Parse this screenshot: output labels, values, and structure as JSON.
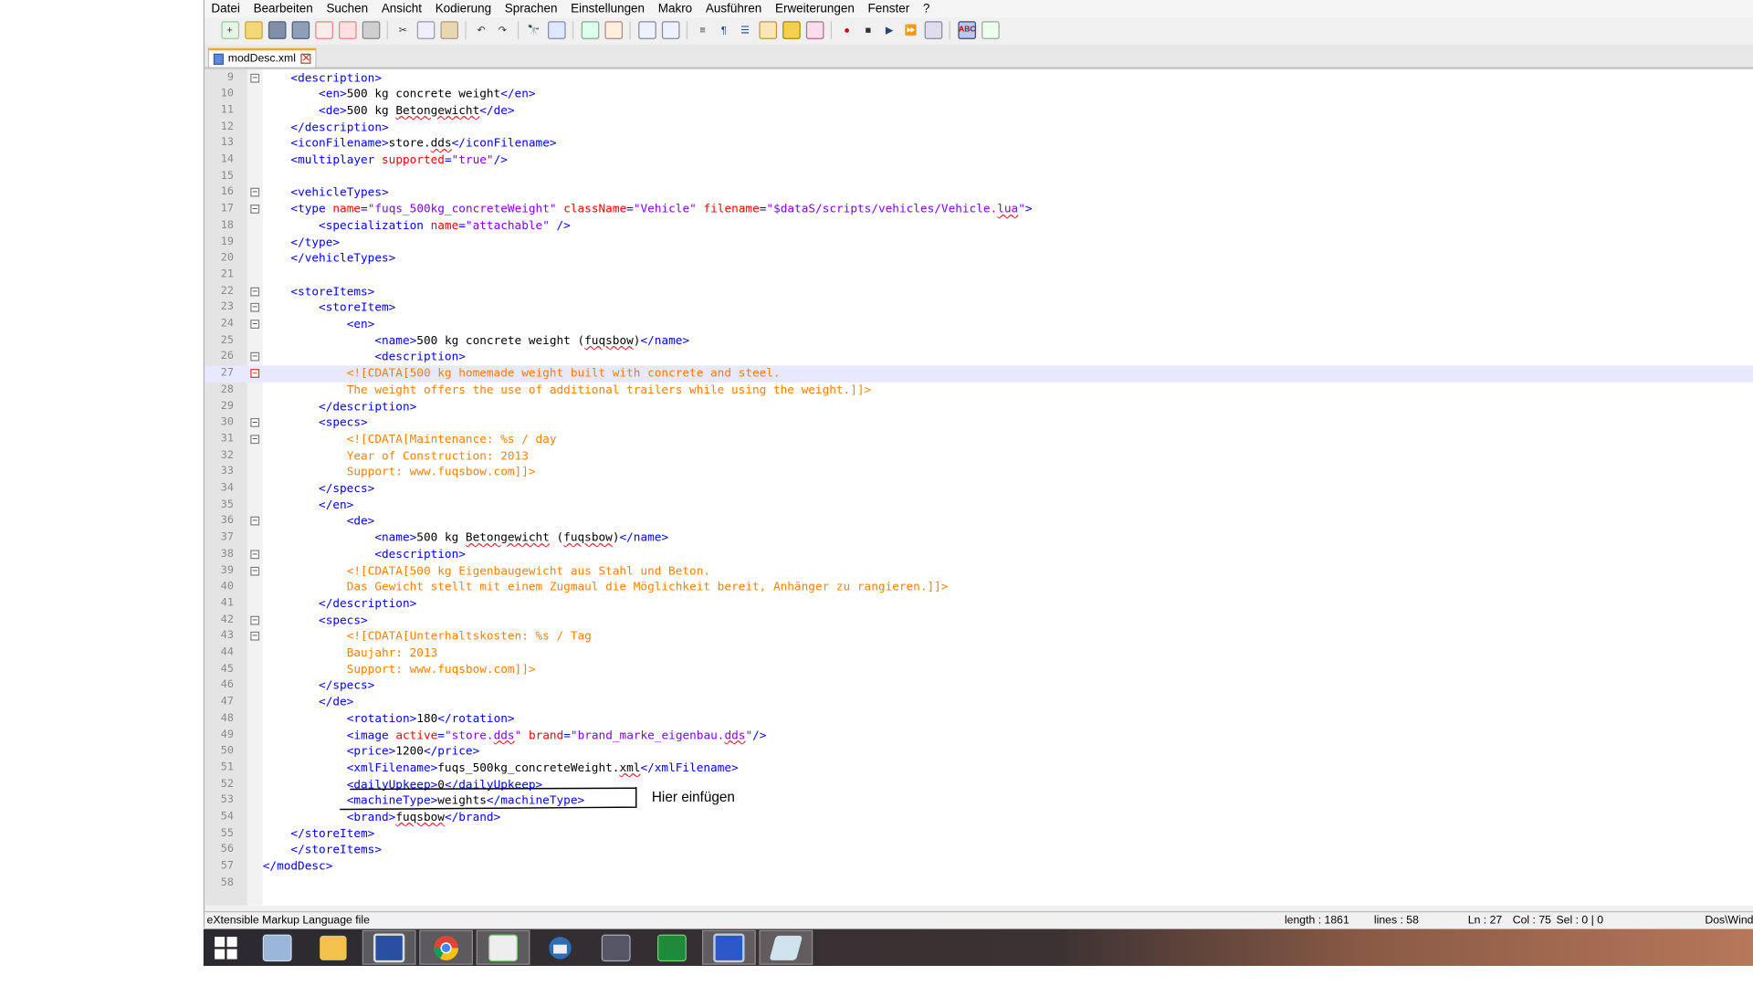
{
  "menu": [
    "Datei",
    "Bearbeiten",
    "Suchen",
    "Ansicht",
    "Kodierung",
    "Sprachen",
    "Einstellungen",
    "Makro",
    "Ausführen",
    "Erweiterungen",
    "Fenster",
    "?"
  ],
  "tab": {
    "filename": "modDesc.xml",
    "close": "✕"
  },
  "code_lines": [
    {
      "n": "9",
      "html": "    <span class='tag'>&lt;description&gt;</span>"
    },
    {
      "n": "10",
      "html": "        <span class='tag'>&lt;en&gt;</span>500 kg concrete weight<span class='tag'>&lt;/en&gt;</span>"
    },
    {
      "n": "11",
      "html": "        <span class='tag'>&lt;de&gt;</span>500 kg <span class='sq'>Betongewicht</span><span class='tag'>&lt;/de&gt;</span>"
    },
    {
      "n": "12",
      "html": "    <span class='tag'>&lt;/description&gt;</span>"
    },
    {
      "n": "13",
      "html": "    <span class='tag'>&lt;iconFilename&gt;</span>store.<span class='sq'>dds</span><span class='tag'>&lt;/iconFilename&gt;</span>"
    },
    {
      "n": "14",
      "html": "    <span class='tag'>&lt;multiplayer </span><span class='attr'>supported</span><span class='tag'>=</span><span class='val'>\"true\"</span><span class='tag'>/&gt;</span>"
    },
    {
      "n": "15",
      "html": ""
    },
    {
      "n": "16",
      "html": "    <span class='tag'>&lt;vehicleTypes&gt;</span>"
    },
    {
      "n": "17",
      "html": "    <span class='tag'>&lt;type </span><span class='attr'>name</span><span class='tag'>=</span><span class='val'>\"fuqs_500kg_concreteWeight\"</span> <span class='attr'>className</span><span class='tag'>=</span><span class='val'>\"Vehicle\"</span> <span class='attr'>filename</span><span class='tag'>=</span><span class='val'>\"$dataS/scripts/vehicles/Vehicle.<span class='sq'>lua</span>\"</span><span class='tag'>&gt;</span>"
    },
    {
      "n": "18",
      "html": "        <span class='tag'>&lt;specialization </span><span class='attr'>name</span><span class='tag'>=</span><span class='val'>\"attachable\"</span><span class='tag'> /&gt;</span>"
    },
    {
      "n": "19",
      "html": "    <span class='tag'>&lt;/type&gt;</span>"
    },
    {
      "n": "20",
      "html": "    <span class='tag'>&lt;/vehicleTypes&gt;</span>"
    },
    {
      "n": "21",
      "html": ""
    },
    {
      "n": "22",
      "html": "    <span class='tag'>&lt;storeItems&gt;</span>"
    },
    {
      "n": "23",
      "html": "        <span class='tag'>&lt;storeItem&gt;</span>"
    },
    {
      "n": "24",
      "html": "            <span class='tag'>&lt;en&gt;</span>"
    },
    {
      "n": "25",
      "html": "                <span class='tag'>&lt;name&gt;</span>500 kg concrete weight (<span class='sq'>fuqsbow</span>)<span class='tag'>&lt;/name&gt;</span>"
    },
    {
      "n": "26",
      "html": "                <span class='tag'>&lt;description&gt;</span>"
    },
    {
      "n": "27",
      "html": "            <span class='cdata'>&lt;![CDATA[500 kg homemade weight built with concrete and steel.</span>"
    },
    {
      "n": "28",
      "html": "            <span class='cdata'>The weight offers the use of additional trailers while using the weight.]]&gt;</span>"
    },
    {
      "n": "29",
      "html": "        <span class='tag'>&lt;/description&gt;</span>"
    },
    {
      "n": "30",
      "html": "        <span class='tag'>&lt;specs&gt;</span>"
    },
    {
      "n": "31",
      "html": "            <span class='cdata'>&lt;![CDATA[Maintenance: %s / day</span>"
    },
    {
      "n": "32",
      "html": "            <span class='cdata'>Year of Construction: 2013</span>"
    },
    {
      "n": "33",
      "html": "            <span class='cdata'>Support: www.fuqsbow.com]]&gt;</span>"
    },
    {
      "n": "34",
      "html": "        <span class='tag'>&lt;/specs&gt;</span>"
    },
    {
      "n": "35",
      "html": "        <span class='tag'>&lt;/en&gt;</span>"
    },
    {
      "n": "36",
      "html": "            <span class='tag'>&lt;de&gt;</span>"
    },
    {
      "n": "37",
      "html": "                <span class='tag'>&lt;name&gt;</span>500 kg <span class='sq'>Betongewicht</span> (<span class='sq'>fuqsbow</span>)<span class='tag'>&lt;/name&gt;</span>"
    },
    {
      "n": "38",
      "html": "                <span class='tag'>&lt;description&gt;</span>"
    },
    {
      "n": "39",
      "html": "            <span class='cdata'>&lt;![CDATA[500 kg Eigenbaugewicht aus Stahl und Beton.</span>"
    },
    {
      "n": "40",
      "html": "            <span class='cdata'>Das Gewicht stellt mit einem Zugmaul die Möglichkeit bereit, Anhänger zu rangieren.]]&gt;</span>"
    },
    {
      "n": "41",
      "html": "        <span class='tag'>&lt;/description&gt;</span>"
    },
    {
      "n": "42",
      "html": "        <span class='tag'>&lt;specs&gt;</span>"
    },
    {
      "n": "43",
      "html": "            <span class='cdata'>&lt;![CDATA[Unterhaltskosten: %s / Tag</span>"
    },
    {
      "n": "44",
      "html": "            <span class='cdata'>Baujahr: 2013</span>"
    },
    {
      "n": "45",
      "html": "            <span class='cdata'>Support: www.fuqsbow.com]]&gt;</span>"
    },
    {
      "n": "46",
      "html": "        <span class='tag'>&lt;/specs&gt;</span>"
    },
    {
      "n": "47",
      "html": "        <span class='tag'>&lt;/de&gt;</span>"
    },
    {
      "n": "48",
      "html": "            <span class='tag'>&lt;rotation&gt;</span>180<span class='tag'>&lt;/rotation&gt;</span>"
    },
    {
      "n": "49",
      "html": "            <span class='tag'>&lt;image </span><span class='attr'>active</span><span class='tag'>=</span><span class='val'>\"store.<span class='sq'>dds</span>\"</span> <span class='attr'>brand</span><span class='tag'>=</span><span class='val'>\"brand_marke_eigenbau.<span class='sq'>dds</span>\"</span><span class='tag'>/&gt;</span>"
    },
    {
      "n": "50",
      "html": "            <span class='tag'>&lt;price&gt;</span>1200<span class='tag'>&lt;/price&gt;</span>"
    },
    {
      "n": "51",
      "html": "            <span class='tag'>&lt;xmlFilename&gt;</span>fuqs_500kg_concreteWeight.<span class='sq'>xml</span><span class='tag'>&lt;/xmlFilename&gt;</span>"
    },
    {
      "n": "52",
      "html": "            <span class='tag'>&lt;dailyUpkeep&gt;</span>0<span class='tag'>&lt;/dailyUpkeep&gt;</span>"
    },
    {
      "n": "53",
      "html": "            <span class='tag'>&lt;machineType&gt;</span>weights<span class='tag'>&lt;/machineType&gt;</span>"
    },
    {
      "n": "54",
      "html": "            <span class='tag'>&lt;brand&gt;</span><span class='sq'>fuqsbow</span><span class='tag'>&lt;/brand&gt;</span>"
    },
    {
      "n": "55",
      "html": "    <span class='tag'>&lt;/storeItem&gt;</span>"
    },
    {
      "n": "56",
      "html": "    <span class='tag'>&lt;/storeItems&gt;</span>"
    },
    {
      "n": "57",
      "html": "<span class='tag'>&lt;/modDesc&gt;</span>"
    },
    {
      "n": "58",
      "html": ""
    }
  ],
  "highlight_line": "27",
  "annotation": "Hier einfügen",
  "status": {
    "filetype": "eXtensible Markup Language file",
    "length": "length : 1861",
    "lines": "lines : 58",
    "ln": "Ln : 27",
    "col": "Col : 75",
    "sel": "Sel : 0 | 0",
    "eol": "Dos\\Wind"
  },
  "taskbar_icons": [
    "windows-start-icon",
    "calculator-icon",
    "file-explorer-icon",
    "save-disk-icon",
    "chrome-icon",
    "notepad-plus-plus-icon",
    "thunderbird-icon",
    "display-settings-icon",
    "excel-icon",
    "simplenote-icon",
    "notes-icon"
  ]
}
